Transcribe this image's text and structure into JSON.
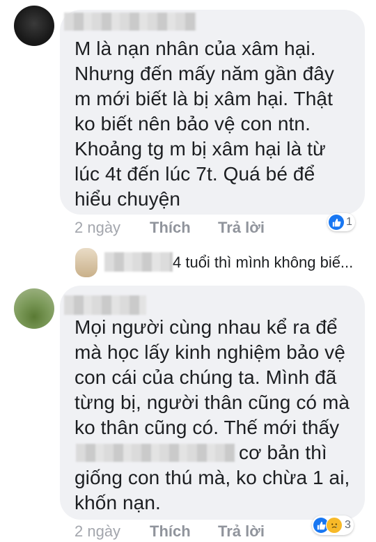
{
  "comments": [
    {
      "lines": [
        "M là nạn nhân của xâm hại.",
        "Nhưng đến mấy năm gần đây",
        "m mới biết là bị xâm hại. Thật",
        "ko biết nên bảo vệ con ntn.",
        "Khoảng tg m bị xâm hại là từ",
        "lúc 4t đến lúc 7t. Quá bé để",
        "hiểu chuyện"
      ],
      "time": "2 ngày",
      "like_label": "Thích",
      "reply_label": "Trả lời",
      "reaction_count": "1"
    },
    {
      "lines": [
        "Mọi người cùng nhau kể ra để",
        "mà học lấy kinh nghiệm bảo vệ",
        "con cái của chúng ta. Mình đã",
        "từng bị, người thân cũng có mà",
        "ko thân cũng có. Thế mới thấy",
        "cơ bản thì",
        "giống con thú mà, ko chừa 1 ai,",
        "khốn nạn."
      ],
      "time": "2 ngày",
      "like_label": "Thích",
      "reply_label": "Trả lời",
      "reaction_count": "3"
    }
  ],
  "reply_preview": {
    "text": "4 tuổi thì mình không biế..."
  },
  "colors": {
    "bubble": "#f0f1f4",
    "like_reaction": "#1877f2",
    "sad_reaction": "#f7b928",
    "action_text": "#90949c"
  },
  "icons": {
    "like_reaction": "thumbs-up-icon",
    "sad_reaction": "sad-face-icon"
  }
}
